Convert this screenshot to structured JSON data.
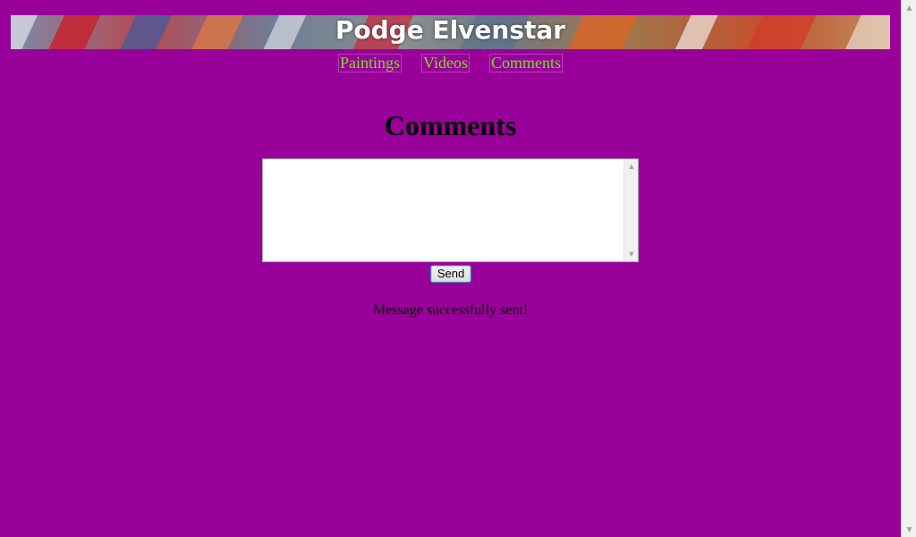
{
  "header": {
    "title": "Podge Elvenstar"
  },
  "nav": {
    "items": [
      {
        "label": "Paintings"
      },
      {
        "label": "Videos"
      },
      {
        "label": "Comments"
      }
    ]
  },
  "main": {
    "heading": "Comments",
    "comment_box": {
      "value": "",
      "placeholder": ""
    },
    "send_label": "Send",
    "status_message": "Message successfully sent!"
  },
  "colors": {
    "background": "#990099",
    "nav_link": "#7ddc2a"
  },
  "icons": {
    "scroll_up": "scroll-up-arrow-icon",
    "scroll_down": "scroll-down-arrow-icon"
  }
}
